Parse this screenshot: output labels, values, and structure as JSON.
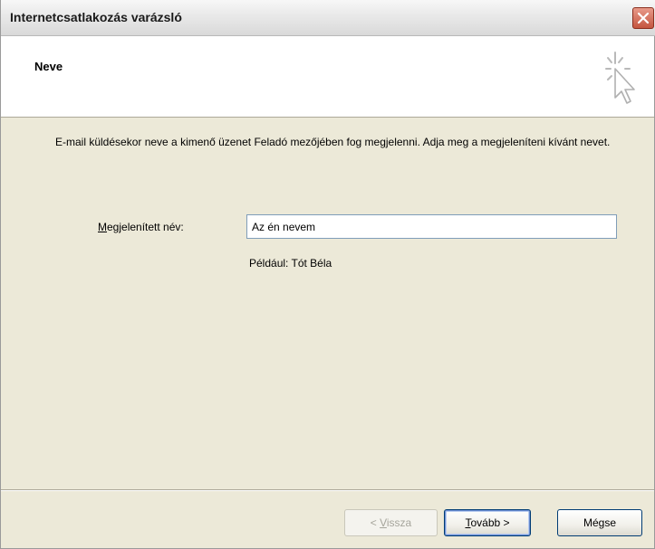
{
  "window": {
    "title": "Internetcsatlakozás varázsló"
  },
  "header": {
    "title": "Neve"
  },
  "body": {
    "description": "E-mail küldésekor neve a kimenő üzenet Feladó mezőjében fog megjelenni. Adja meg a megjeleníteni kívánt nevet.",
    "field_label_accel": "M",
    "field_label_rest": "egjelenített név:",
    "field_value": "Az én nevem",
    "example": "Például: Tót Béla"
  },
  "buttons": {
    "back_prefix": "< ",
    "back_accel": "V",
    "back_rest": "issza",
    "next_accel": "T",
    "next_rest": "ovább >",
    "cancel": "Mégse"
  },
  "colors": {
    "dialog_bg": "#ece9d8",
    "header_bg": "#ffffff",
    "close_button": "#c4553f",
    "input_border": "#7f9db9"
  },
  "icons": {
    "close": "close-icon",
    "wizard": "wizard-cursor-icon"
  }
}
